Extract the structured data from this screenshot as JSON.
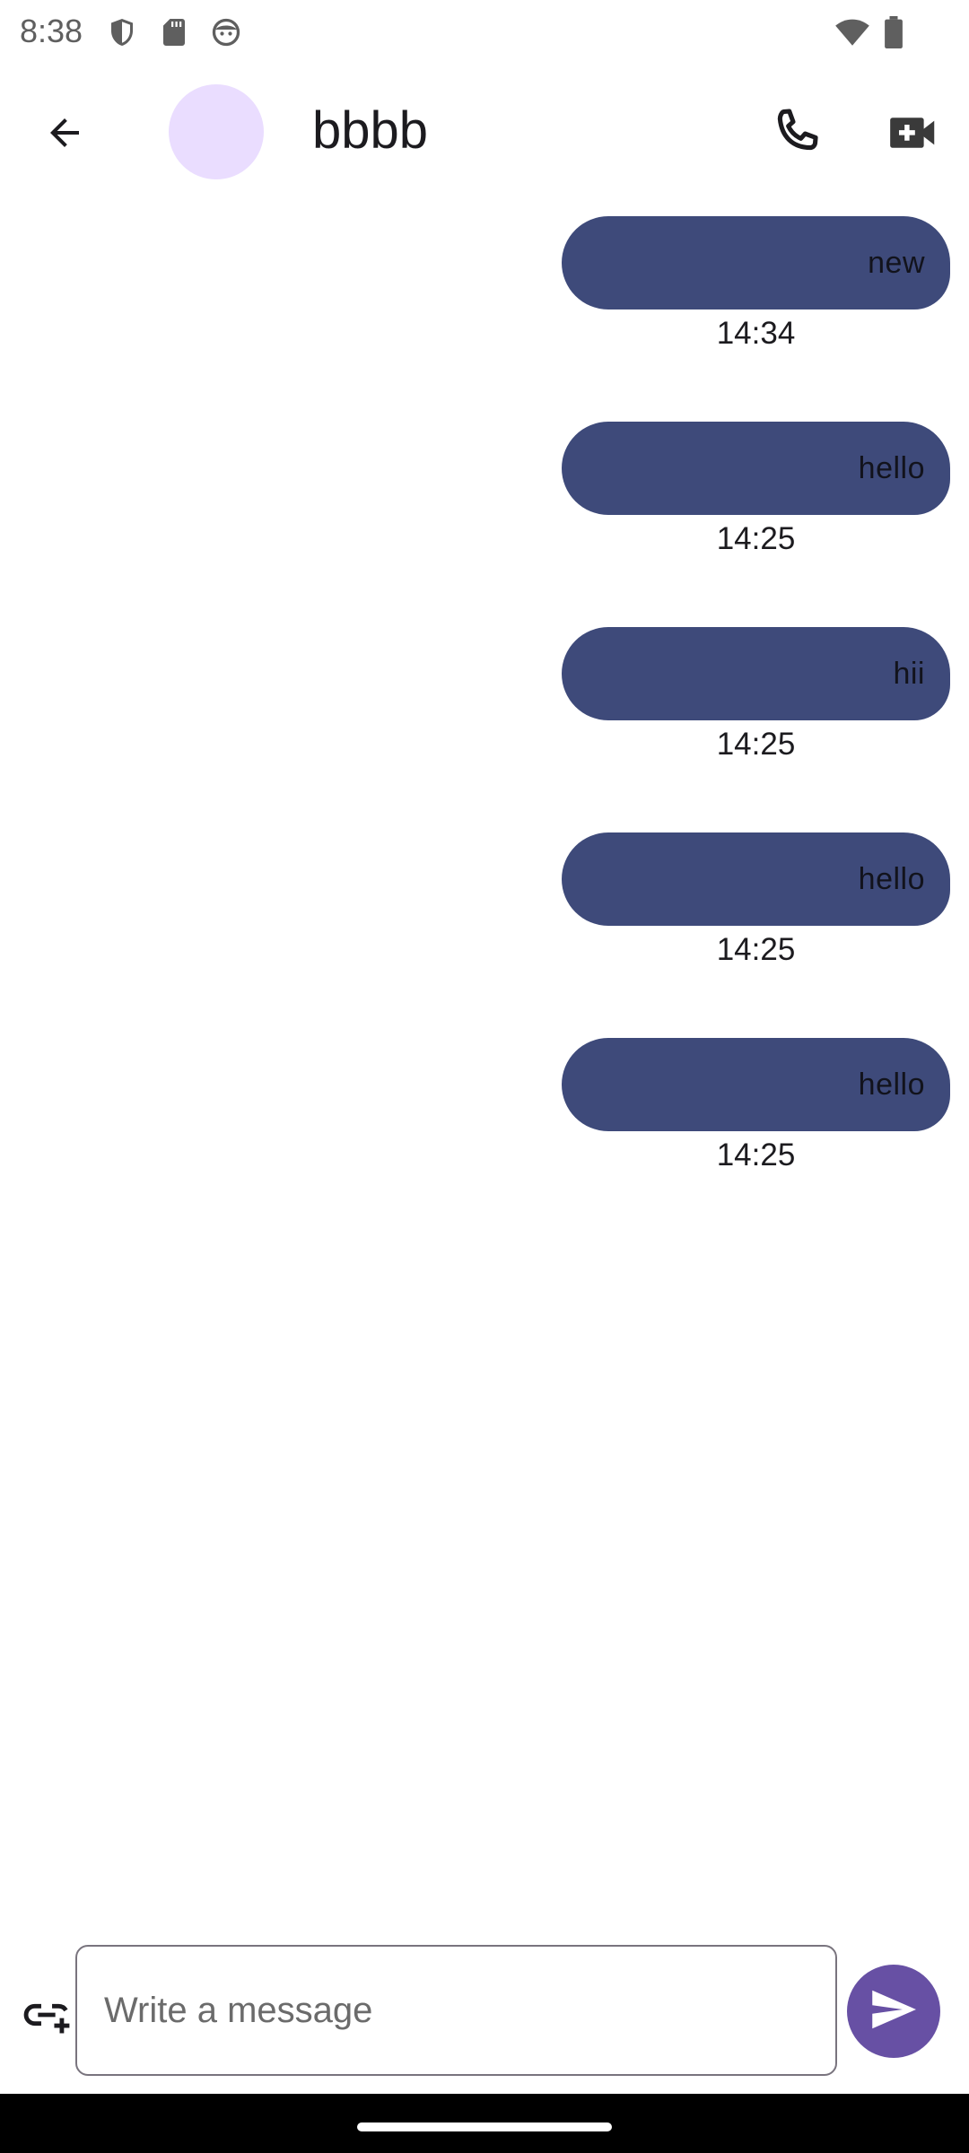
{
  "status_bar": {
    "time": "8:38",
    "icons": [
      "shield-icon",
      "sd-card-icon",
      "face-icon",
      "wifi-icon",
      "battery-icon"
    ]
  },
  "header": {
    "contact_name": "bbbb",
    "back_icon": "arrow-back-icon",
    "call_icon": "phone-icon",
    "video_icon": "video-call-icon"
  },
  "messages": [
    {
      "text": "new",
      "time": "14:34"
    },
    {
      "text": "hello",
      "time": "14:25"
    },
    {
      "text": "hii",
      "time": "14:25"
    },
    {
      "text": "hello",
      "time": "14:25"
    },
    {
      "text": "hello",
      "time": "14:25"
    }
  ],
  "composer": {
    "placeholder": "Write a message",
    "value": "",
    "attach_icon": "add-link-icon",
    "send_icon": "send-icon"
  },
  "colors": {
    "bubble": "#3e4a7a",
    "avatar": "#eaddff",
    "send_button": "#6750a4"
  }
}
